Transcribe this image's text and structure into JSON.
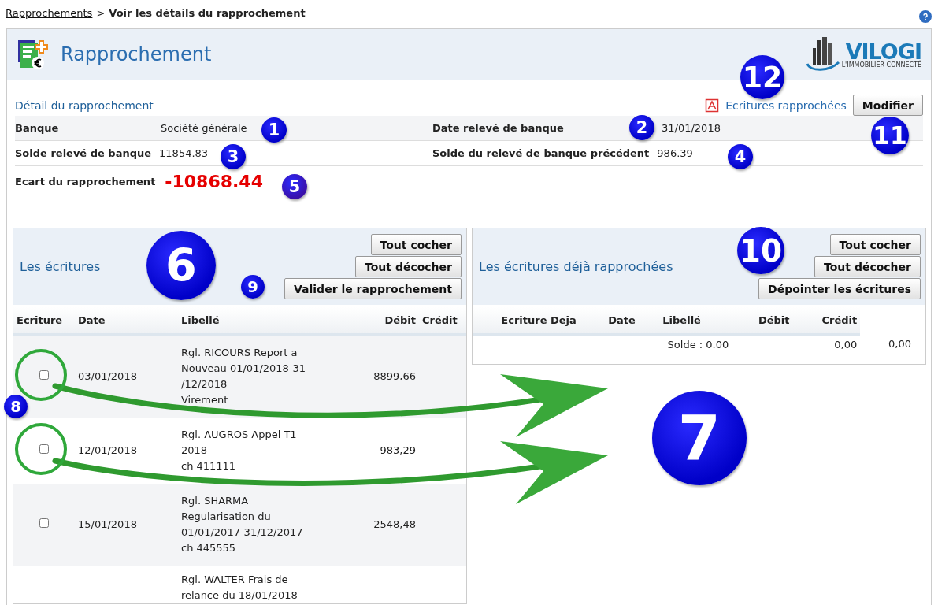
{
  "breadcrumb": {
    "link": "Rapprochements",
    "separator": ">",
    "current": "Voir les détails du rapprochement"
  },
  "header": {
    "title": "Rapprochement",
    "logo_name": "VILOGI",
    "logo_tagline": "L'IMMOBILIER CONNECTÉ"
  },
  "detail": {
    "title": "Détail du rapprochement",
    "pdf_link": "Ecritures rapprochées",
    "modify_button": "Modifier",
    "rows": [
      [
        {
          "label": "Banque",
          "value": "Société générale"
        },
        {
          "label": "Date relevé de banque",
          "value": "31/01/2018"
        }
      ],
      [
        {
          "label": "Solde relevé de banque",
          "value": "11854.83"
        },
        {
          "label": "Solde du relevé de banque précédent",
          "value": "986.39"
        }
      ]
    ],
    "gap": {
      "label": "Ecart du rapprochement",
      "value": "-10868.44"
    }
  },
  "left_panel": {
    "title": "Les écritures",
    "buttons": [
      "Tout cocher",
      "Tout décocher",
      "Valider le rapprochement"
    ],
    "columns": [
      "Ecriture",
      "Date",
      "Libellé",
      "Débit",
      "Crédit"
    ],
    "rows": [
      {
        "checked": false,
        "date": "03/01/2018",
        "label": "Rgl. RICOURS Report a\nNouveau 01/01/2018-31\n/12/2018\nVirement",
        "debit": "8899,66"
      },
      {
        "checked": false,
        "date": "12/01/2018",
        "label": "Rgl. AUGROS Appel T1\n2018\nch 411111",
        "debit": "983,29"
      },
      {
        "checked": false,
        "date": "15/01/2018",
        "label": "Rgl. SHARMA\nRegularisation du\n01/01/2017-31/12/2017\nch 445555",
        "debit": "2548,48"
      },
      {
        "label": "Rgl. WALTER Frais de\nrelance du 18/01/2018 -"
      }
    ]
  },
  "right_panel": {
    "title": "Les écritures déjà rapprochées",
    "buttons": [
      "Tout cocher",
      "Tout décocher",
      "Dépointer les écritures"
    ],
    "columns": [
      "Ecriture Deja",
      "Date",
      "Libellé",
      "Débit",
      "Crédit"
    ],
    "total": {
      "label": "Solde : 0.00",
      "debit": "0,00",
      "credit": "0,00"
    }
  },
  "annotations": [
    "1",
    "2",
    "3",
    "4",
    "5",
    "6",
    "7",
    "8",
    "9",
    "10",
    "11",
    "12"
  ]
}
